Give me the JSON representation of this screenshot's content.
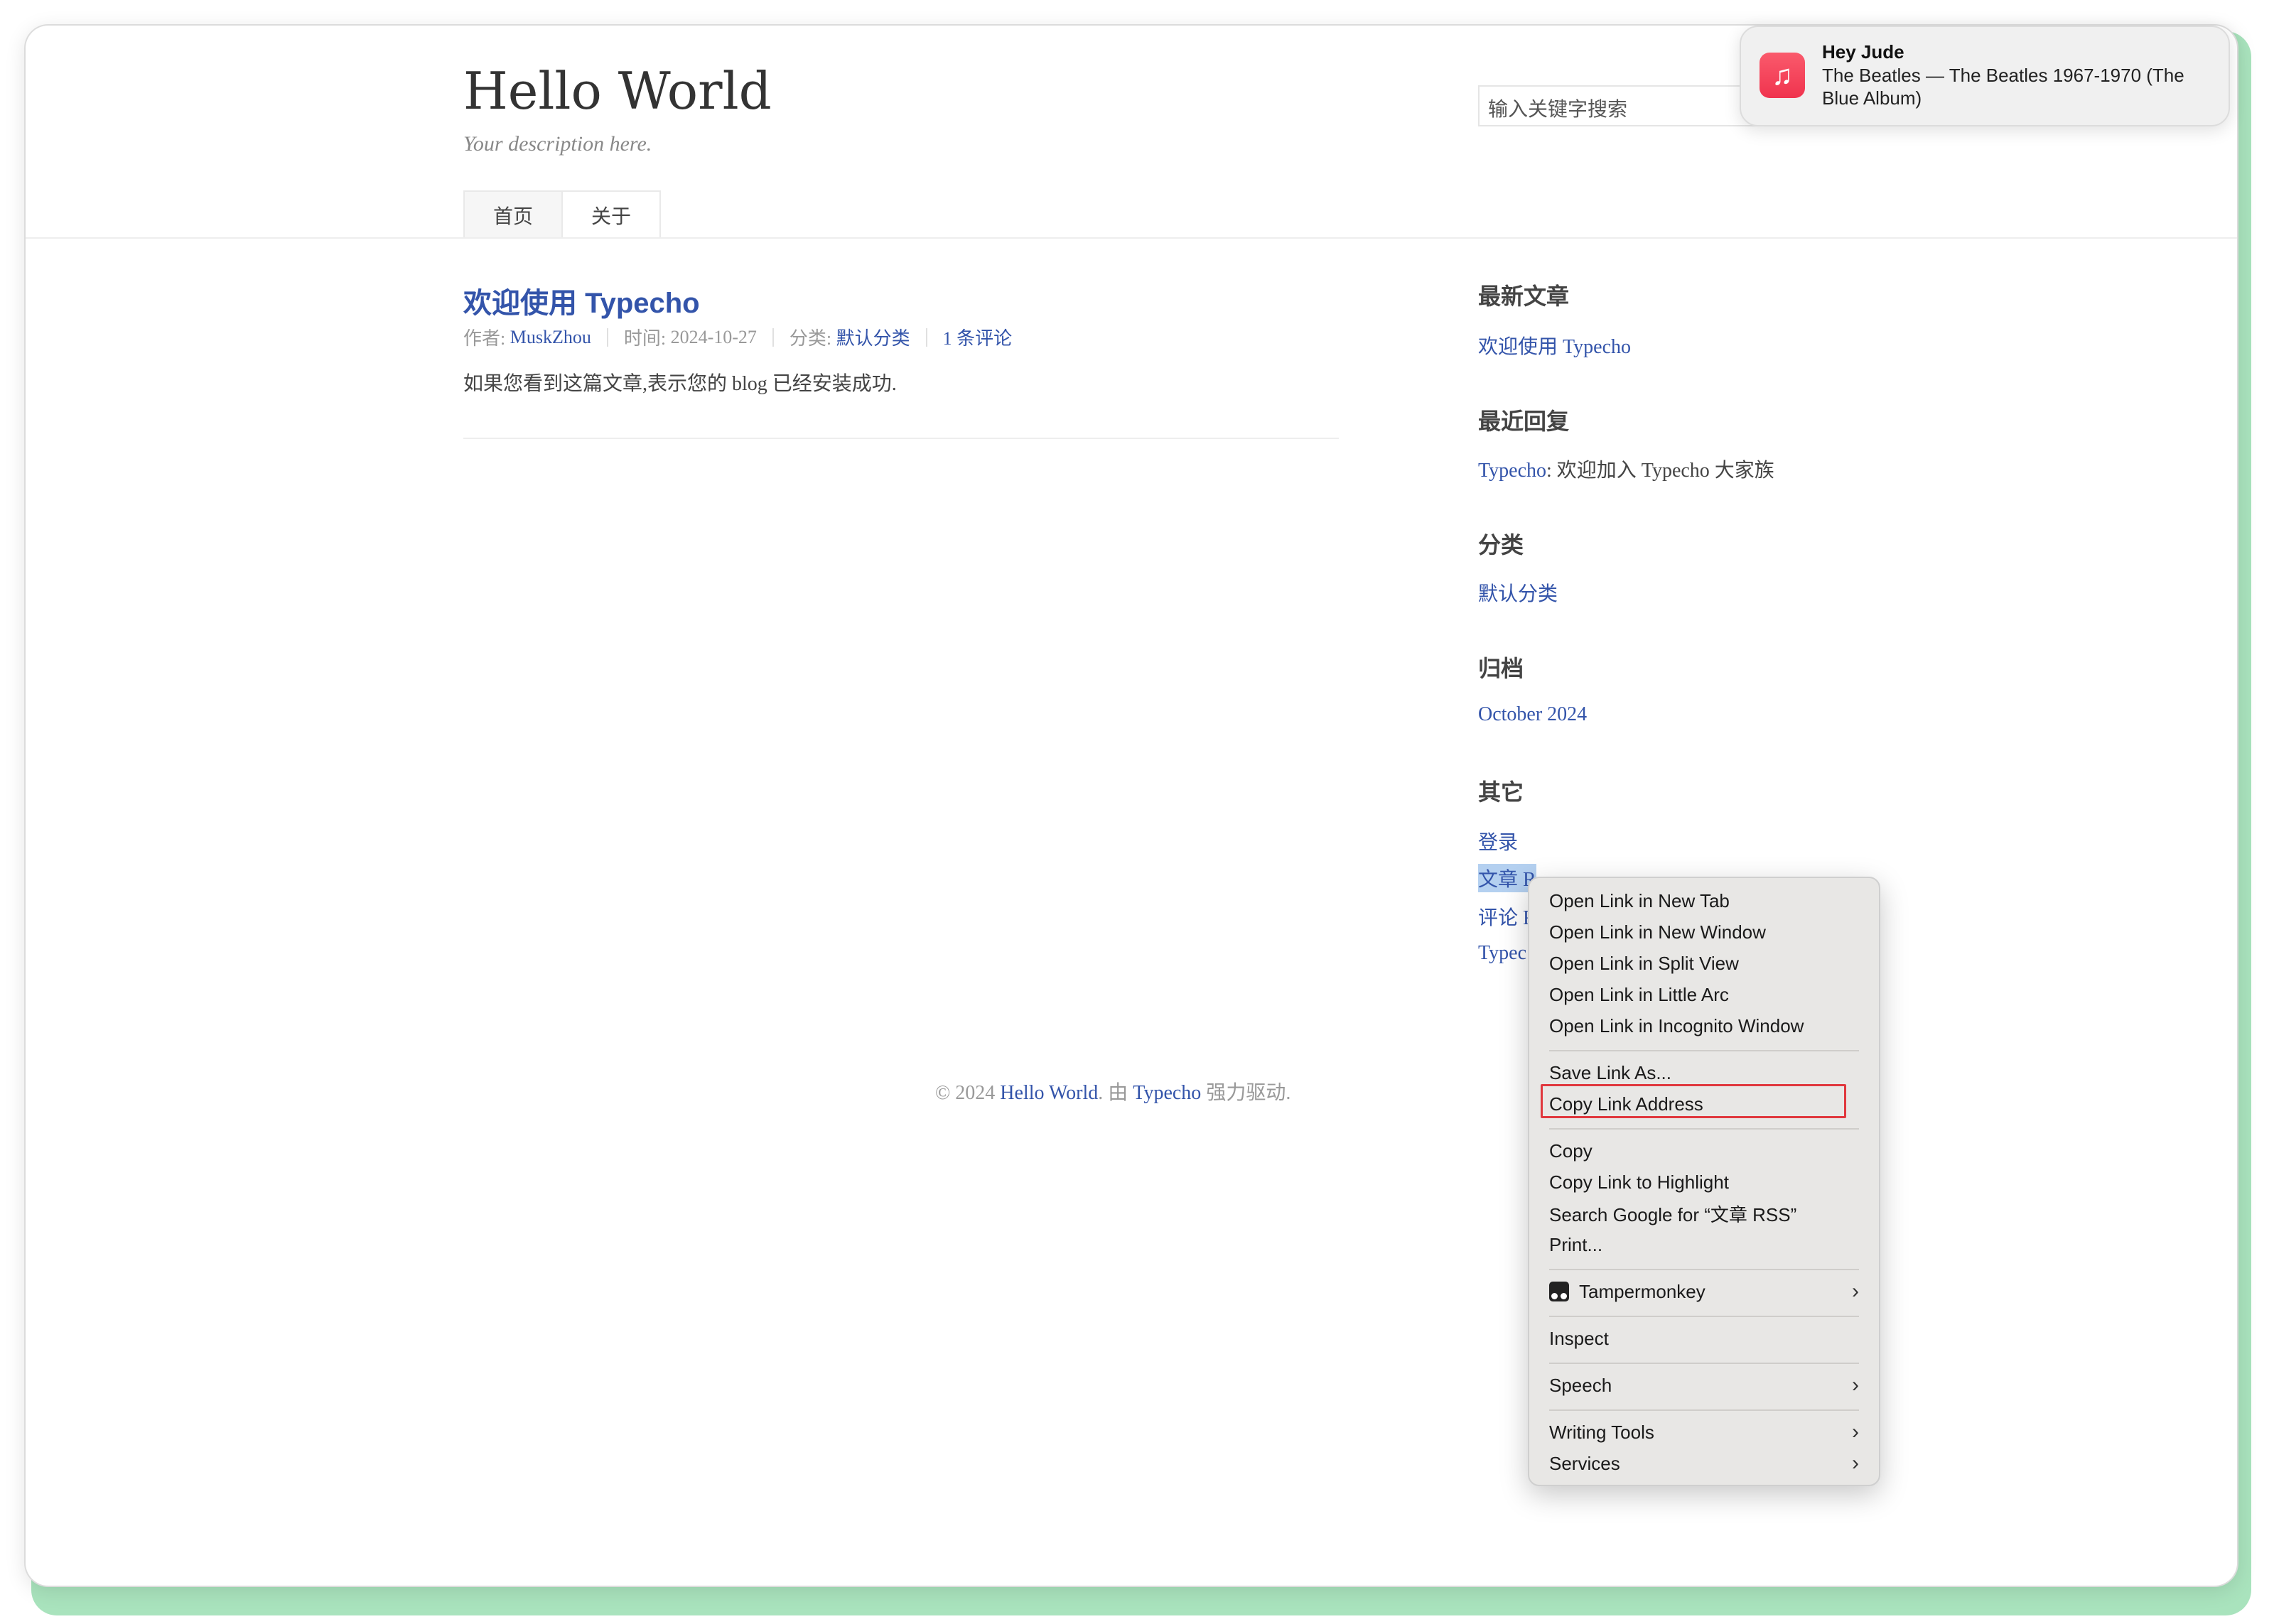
{
  "site": {
    "title": "Hello World",
    "description": "Your description here.",
    "search_placeholder": "输入关键字搜索",
    "nav": [
      "首页",
      "关于"
    ]
  },
  "post": {
    "title": "欢迎使用 Typecho",
    "author_label": "作者:",
    "author": "MuskZhou",
    "time_label": "时间:",
    "time": "2024-10-27",
    "category_label": "分类:",
    "category": "默认分类",
    "comments": "1 条评论",
    "excerpt": "如果您看到这篇文章,表示您的 blog 已经安装成功."
  },
  "sidebar": {
    "recent_posts_title": "最新文章",
    "recent_posts": [
      "欢迎使用 Typecho"
    ],
    "recent_comments_title": "最近回复",
    "recent_comment_author": "Typecho",
    "recent_comment_text": ": 欢迎加入 Typecho 大家族",
    "categories_title": "分类",
    "categories": [
      "默认分类"
    ],
    "archives_title": "归档",
    "archives": [
      "October 2024"
    ],
    "other_title": "其它",
    "other_login": "登录",
    "other_post_rss_partial": "文章 R",
    "other_comment_rss_partial": "评论 R",
    "other_typecho_partial": "Typec"
  },
  "footer": {
    "prefix": "© 2024 ",
    "site_link": "Hello World",
    "middle": ". 由 ",
    "typecho_link": "Typecho",
    "suffix": " 强力驱动."
  },
  "notification": {
    "title": "Hey Jude",
    "body": "The Beatles — The Beatles 1967-1970 (The Blue Album)",
    "icon": "music-note-icon"
  },
  "context_menu": {
    "group1": [
      "Open Link in New Tab",
      "Open Link in New Window",
      "Open Link in Split View",
      "Open Link in Little Arc",
      "Open Link in Incognito Window"
    ],
    "group2": [
      "Save Link As...",
      "Copy Link Address"
    ],
    "group3": [
      "Copy",
      "Copy Link to Highlight",
      "Search Google for “文章 RSS”",
      "Print..."
    ],
    "tampermonkey": "Tampermonkey",
    "inspect": "Inspect",
    "speech": "Speech",
    "writing_tools": "Writing Tools",
    "services": "Services",
    "highlighted": "Copy Link Address"
  },
  "colors": {
    "link": "#3354aa",
    "focus_outline": "#e0383e",
    "frame_accent": "#a9e3bd"
  }
}
